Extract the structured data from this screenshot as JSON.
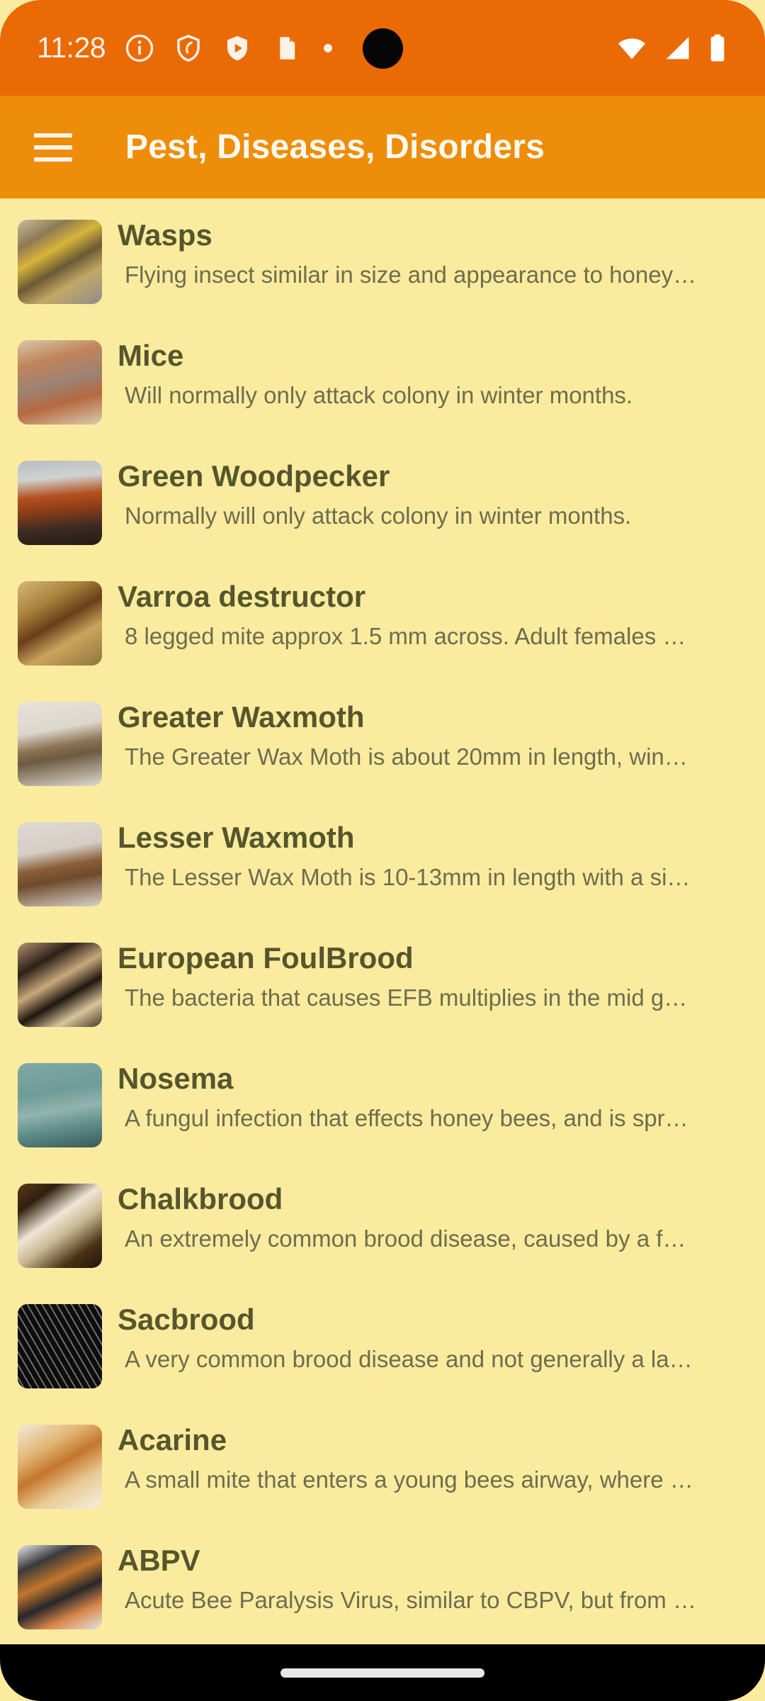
{
  "status_bar": {
    "time": "11:28",
    "left_icons": [
      "info-circle-icon",
      "shield-outline-icon",
      "shield-play-icon",
      "sd-card-icon",
      "dot-icon"
    ],
    "right_icons": [
      "wifi-icon",
      "cellular-signal-icon",
      "battery-icon"
    ],
    "background_color": "#ea6a06"
  },
  "app_bar": {
    "menu_icon": "hamburger-menu-icon",
    "title": "Pest, Diseases, Disorders",
    "background_color": "#ee8d09",
    "title_color": "#fffaf0"
  },
  "page": {
    "background_color": "#faeb9f",
    "title_color": "#55562c",
    "subtitle_color": "#6e6d4d"
  },
  "list": {
    "items": [
      {
        "title": "Wasps",
        "subtitle": "Flying insect similar in size and appearance to honey…",
        "thumb": "wasps-on-comb-photo"
      },
      {
        "title": "Mice",
        "subtitle": "Will normally only attack colony in winter months.",
        "thumb": "mouse-in-hive-photo"
      },
      {
        "title": "Green Woodpecker",
        "subtitle": "Normally will only attack colony in winter months.",
        "thumb": "woodpecker-damage-photo"
      },
      {
        "title": "Varroa destructor",
        "subtitle": "8 legged mite approx 1.5 mm across. Adult females …",
        "thumb": "varroa-mite-on-bee-photo"
      },
      {
        "title": "Greater Waxmoth",
        "subtitle": "The Greater Wax Moth is about 20mm in length, win…",
        "thumb": "greater-wax-moth-photo"
      },
      {
        "title": "Lesser Waxmoth",
        "subtitle": "The Lesser Wax Moth is 10-13mm in length with a si…",
        "thumb": "lesser-wax-moth-photo"
      },
      {
        "title": "European FoulBrood",
        "subtitle": "The bacteria that causes EFB multiplies in the mid g…",
        "thumb": "european-foulbrood-comb-photo"
      },
      {
        "title": "Nosema",
        "subtitle": "A fungul infection that effects honey bees, and is spr…",
        "thumb": "nosema-dysentery-photo"
      },
      {
        "title": "Chalkbrood",
        "subtitle": "An extremely common brood disease, caused by a f…",
        "thumb": "chalkbrood-mummy-photo"
      },
      {
        "title": "Sacbrood",
        "subtitle": "A very common brood disease and not generally a la…",
        "thumb": "sacbrood-comb-photo"
      },
      {
        "title": "Acarine",
        "subtitle": "A small mite that enters a young bees airway, where …",
        "thumb": "acarine-trachea-photo"
      },
      {
        "title": "ABPV",
        "subtitle": "Acute Bee Paralysis Virus, similar to CBPV, but from …",
        "thumb": "abpv-bees-photo"
      }
    ]
  },
  "nav_bar": {
    "gesture_pill": "home-gesture-pill",
    "background_color": "#000000"
  }
}
